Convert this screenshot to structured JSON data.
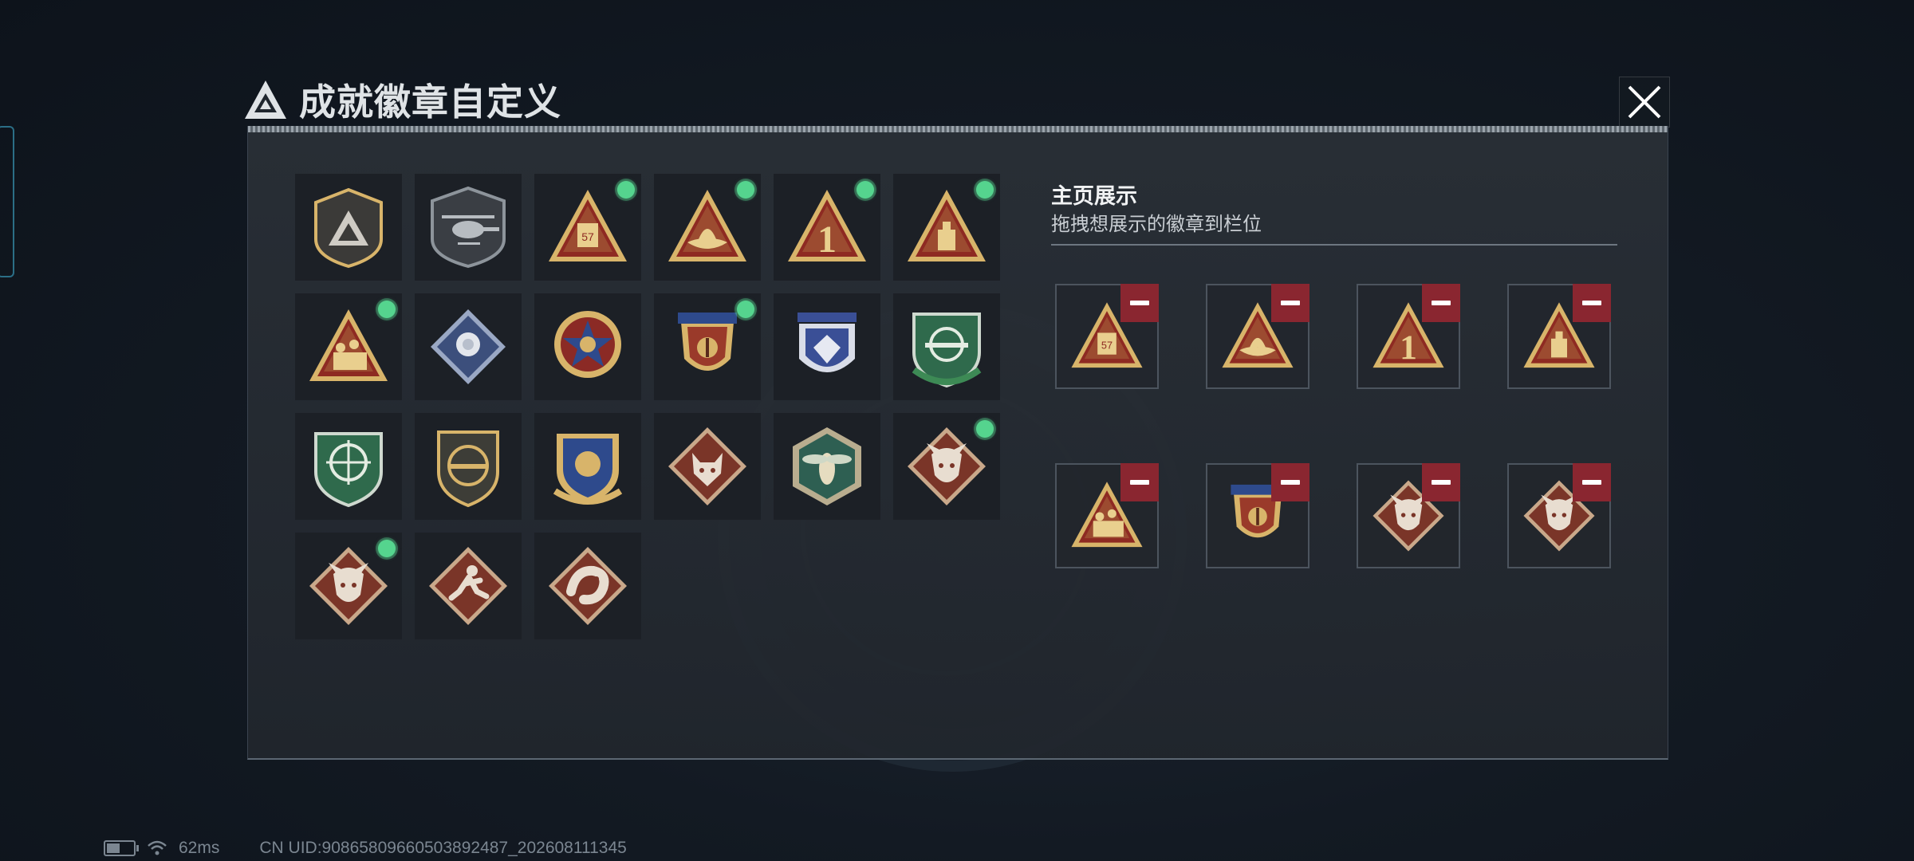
{
  "window": {
    "title": "成就徽章自定义"
  },
  "showcase": {
    "title": "主页展示",
    "subtitle": "拖拽想展示的徽章到栏位"
  },
  "colors": {
    "gold": "#d8b46a",
    "gold_dark": "#8f6a2c",
    "red": "#8e2a22",
    "green": "#2f6a4c",
    "blue": "#2e4a8c",
    "rust": "#7a3528",
    "indicator": "#55d48e",
    "remove": "#8a2630"
  },
  "badges": [
    {
      "icon": "shield-triangle-badge-icon",
      "selected": false
    },
    {
      "icon": "helicopter-badge-icon",
      "selected": false
    },
    {
      "icon": "bunker-triangle-badge-icon",
      "selected": true
    },
    {
      "icon": "boat-triangle-badge-icon",
      "selected": true
    },
    {
      "icon": "number-one-triangle-badge-icon",
      "selected": true
    },
    {
      "icon": "tower-triangle-badge-icon",
      "selected": true
    },
    {
      "icon": "soldiers-triangle-badge-icon",
      "selected": true
    },
    {
      "icon": "rose-diamond-badge-icon",
      "selected": false
    },
    {
      "icon": "star-medal-badge-icon",
      "selected": false
    },
    {
      "icon": "winged-shield-badge-icon",
      "selected": true
    },
    {
      "icon": "blue-gem-shield-badge-icon",
      "selected": false
    },
    {
      "icon": "green-rifle-shield-badge-icon",
      "selected": false
    },
    {
      "icon": "green-crosshair-shield-badge-icon",
      "selected": false
    },
    {
      "icon": "dark-rifle-shield-badge-icon",
      "selected": false
    },
    {
      "icon": "blue-gold-crest-badge-icon",
      "selected": false
    },
    {
      "icon": "wolf-diamond-badge-icon",
      "selected": false
    },
    {
      "icon": "wasp-hexagon-badge-icon",
      "selected": false
    },
    {
      "icon": "dragon-diamond-badge-icon",
      "selected": true
    },
    {
      "icon": "dragon-diamond-badge-icon",
      "selected": true
    },
    {
      "icon": "runner-diamond-badge-icon",
      "selected": false
    },
    {
      "icon": "serpent-diamond-badge-icon",
      "selected": false
    }
  ],
  "slots": [
    {
      "icon": "bunker-triangle-badge-icon"
    },
    {
      "icon": "boat-triangle-badge-icon"
    },
    {
      "icon": "number-one-triangle-badge-icon"
    },
    {
      "icon": "tower-triangle-badge-icon"
    },
    {
      "icon": "soldiers-triangle-badge-icon"
    },
    {
      "icon": "winged-shield-badge-icon"
    },
    {
      "icon": "dragon-diamond-badge-icon"
    },
    {
      "icon": "dragon-diamond-badge-icon"
    }
  ],
  "status": {
    "ping": "62ms",
    "uid": "CN UID:90865809660503892487_202608111345"
  }
}
